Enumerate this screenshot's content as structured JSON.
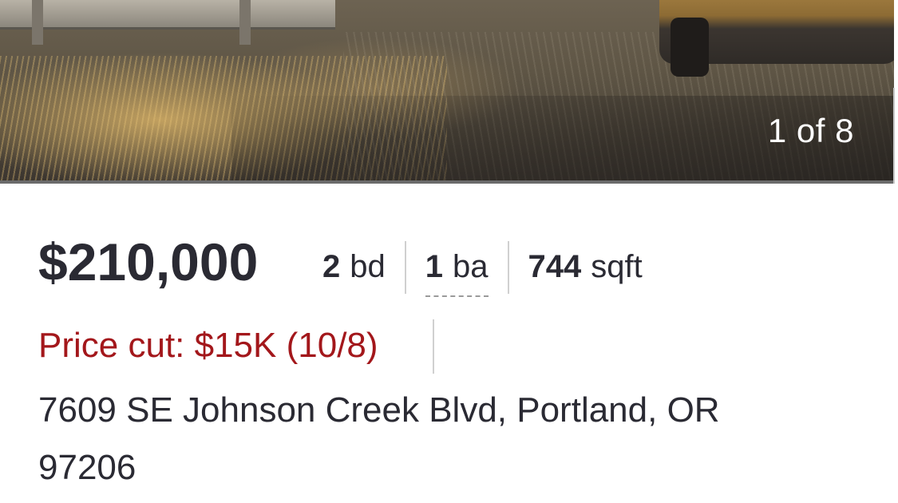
{
  "photo": {
    "counter": "1 of 8"
  },
  "listing": {
    "price": "$210,000",
    "beds": {
      "num": "2",
      "unit": "bd"
    },
    "baths": {
      "num": "1",
      "unit": "ba"
    },
    "sqft": {
      "num": "744",
      "unit": "sqft"
    },
    "price_cut": "Price cut: $15K (10/8)",
    "address_line1": "7609 SE Johnson Creek Blvd, Portland, OR",
    "address_line2": "97206"
  },
  "colors": {
    "price_cut": "#a3171b",
    "text": "#2a2a33"
  }
}
